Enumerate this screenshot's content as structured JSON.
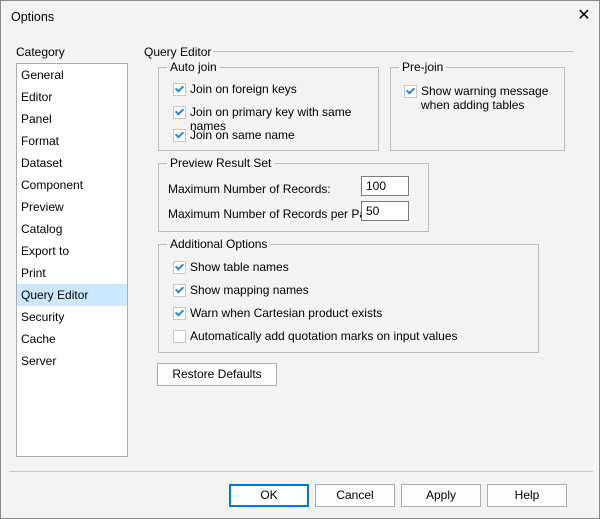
{
  "window": {
    "title": "Options",
    "close_icon": "close-icon"
  },
  "category": {
    "label": "Category",
    "items": [
      "General",
      "Editor",
      "Panel",
      "Format",
      "Dataset",
      "Component",
      "Preview",
      "Catalog",
      "Export to",
      "Print",
      "Query Editor",
      "Security",
      "Cache",
      "Server"
    ],
    "selected": "Query Editor"
  },
  "query_editor": {
    "title": "Query Editor",
    "auto_join": {
      "title": "Auto join",
      "options": [
        {
          "label": "Join on foreign keys",
          "checked": true
        },
        {
          "label": "Join on primary key with same names",
          "checked": true
        },
        {
          "label": "Join on same name",
          "checked": true
        }
      ]
    },
    "pre_join": {
      "title": "Pre-join",
      "option": {
        "label_line1": "Show warning message",
        "label_line2": "when adding tables",
        "checked": true
      }
    },
    "preview": {
      "title": "Preview Result Set",
      "max_records_label": "Maximum Number of Records:",
      "max_records": "100",
      "per_page_label": "Maximum Number of Records per Page:",
      "per_page": "50"
    },
    "additional": {
      "title": "Additional Options",
      "options": [
        {
          "label": "Show table names",
          "checked": true
        },
        {
          "label": "Show mapping names",
          "checked": true
        },
        {
          "label": "Warn when Cartesian product exists",
          "checked": true
        },
        {
          "label": "Automatically add quotation marks on input values",
          "checked": false
        }
      ]
    },
    "restore_defaults": "Restore Defaults"
  },
  "buttons": {
    "ok": "OK",
    "cancel": "Cancel",
    "apply": "Apply",
    "help": "Help"
  },
  "colors": {
    "selection": "#cce8ff",
    "accent": "#0078d7",
    "check": "#2a8ad4"
  }
}
